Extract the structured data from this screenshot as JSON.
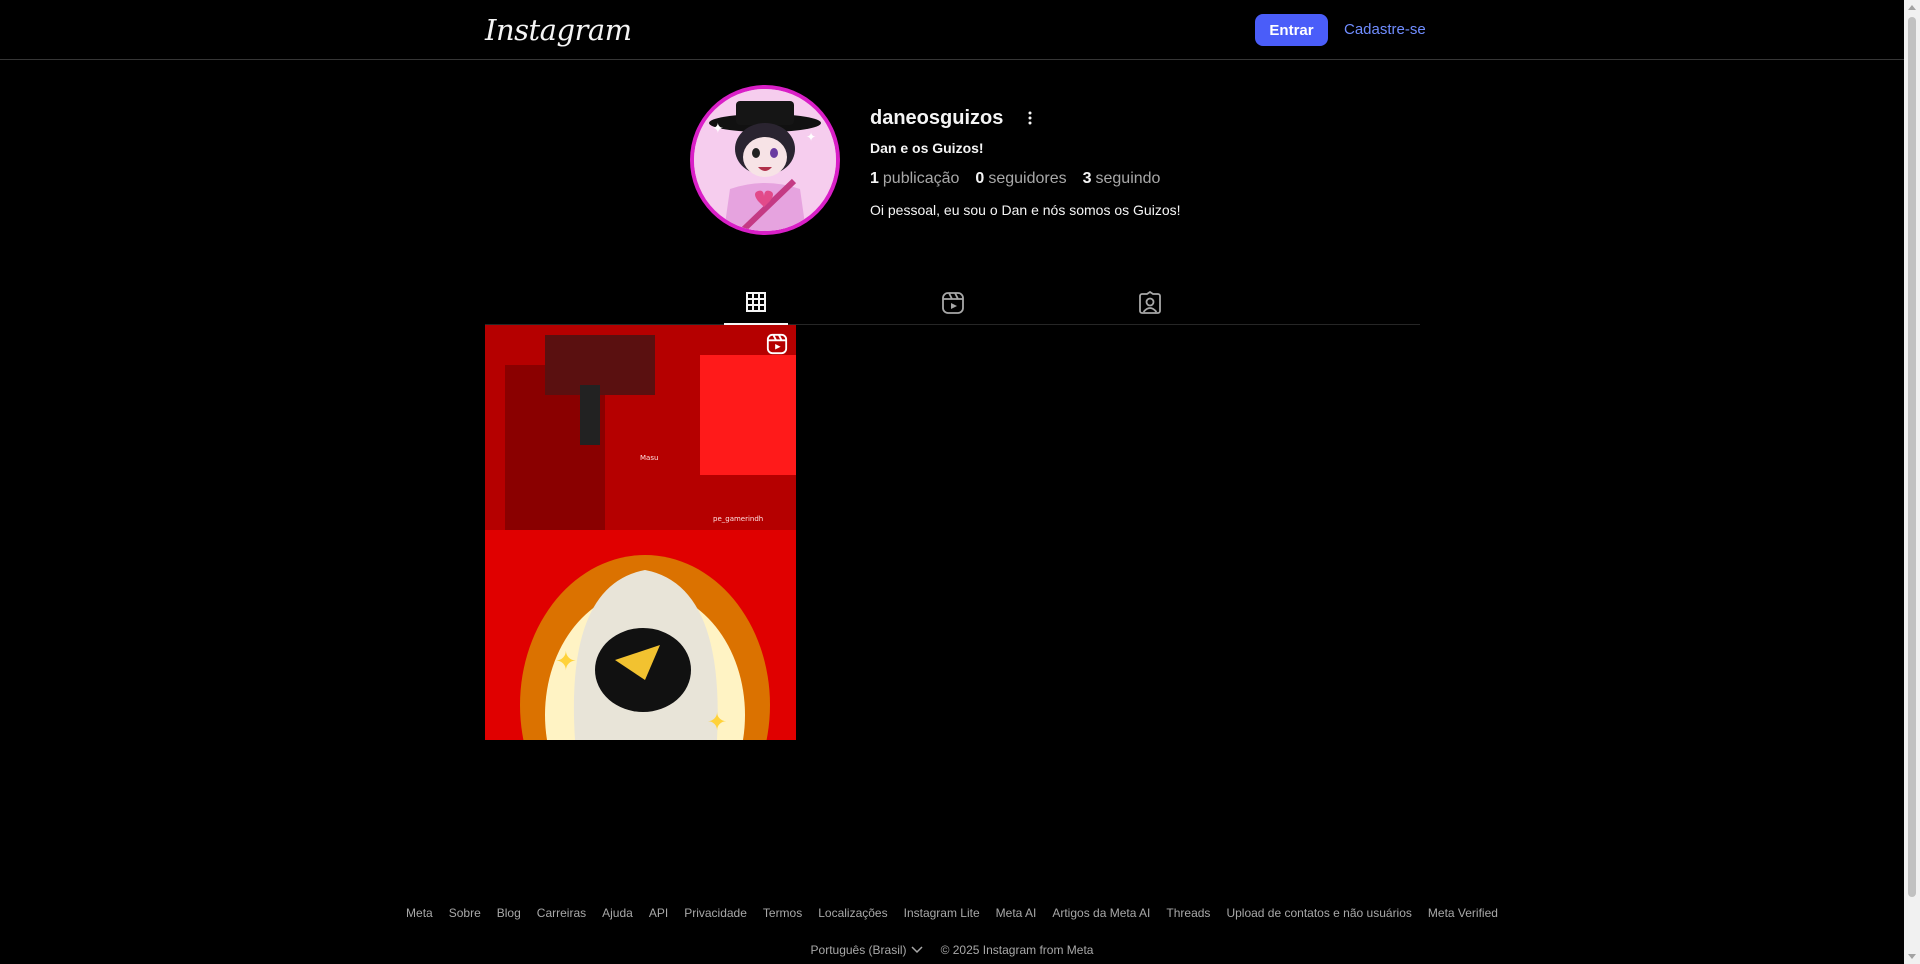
{
  "header": {
    "logo_text": "Instagram",
    "login_label": "Entrar",
    "signup_label": "Cadastre-se"
  },
  "profile": {
    "username": "daneosguizos",
    "full_name": "Dan e os Guizos!",
    "posts_count": "1",
    "posts_label": "publicação",
    "followers_count": "0",
    "followers_label": "seguidores",
    "following_count": "3",
    "following_label": "seguindo",
    "bio": "Oi pessoal, eu sou o Dan e nós somos os Guizos!"
  },
  "tabs": [
    {
      "icon": "grid-icon",
      "active": true
    },
    {
      "icon": "reels-icon",
      "active": false
    },
    {
      "icon": "tagged-icon",
      "active": false
    }
  ],
  "posts": [
    {
      "type": "reel",
      "overlay_texts": [
        "Masu",
        "pe_gamerindh"
      ]
    }
  ],
  "footer": {
    "links": [
      "Meta",
      "Sobre",
      "Blog",
      "Carreiras",
      "Ajuda",
      "API",
      "Privacidade",
      "Termos",
      "Localizações",
      "Instagram Lite",
      "Meta AI",
      "Artigos da Meta AI",
      "Threads",
      "Upload de contatos e não usuários",
      "Meta Verified"
    ],
    "language": "Português (Brasil)",
    "copyright": "© 2025 Instagram from Meta"
  },
  "colors": {
    "accent": "#4a5df9",
    "link": "#708dff",
    "avatar_ring": "#d91fc7",
    "background": "#000000"
  }
}
